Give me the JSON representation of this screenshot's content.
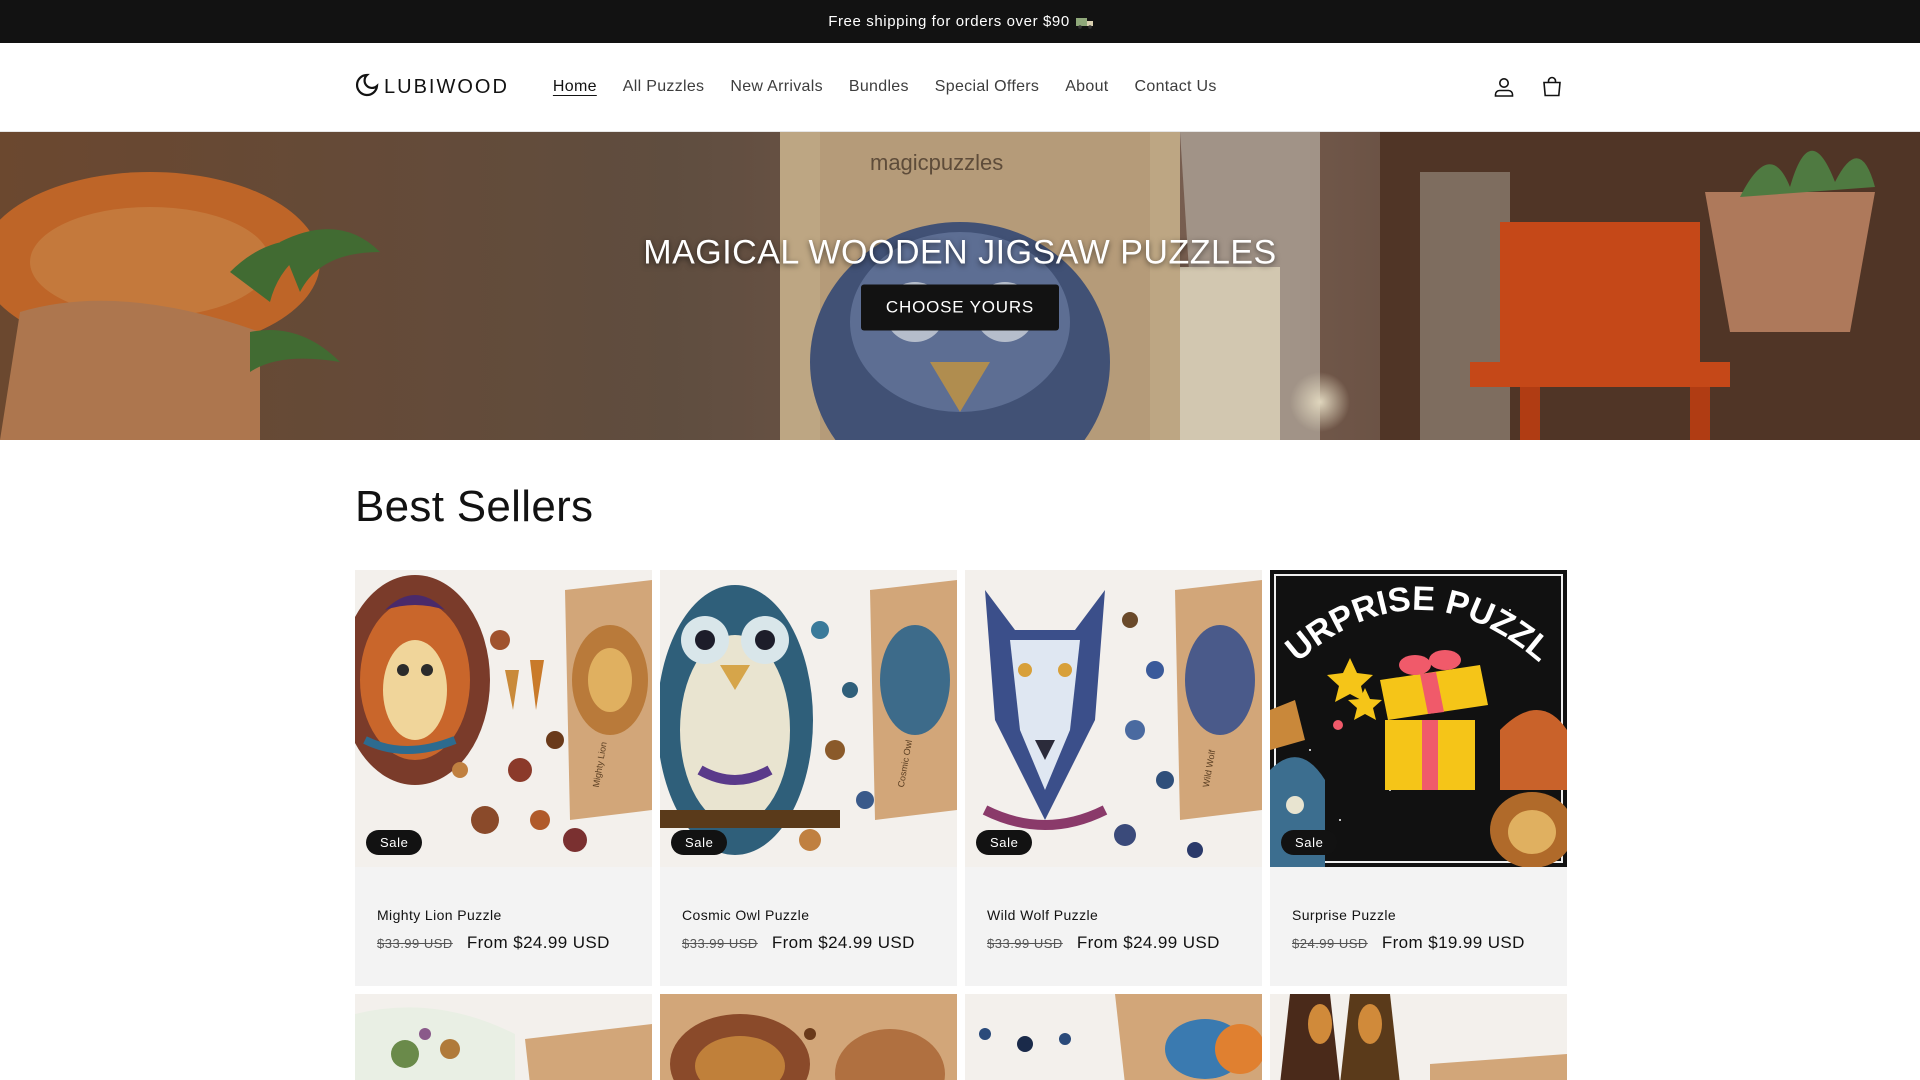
{
  "announcement": {
    "text": "Free shipping for orders over  $90"
  },
  "header": {
    "logo_text": "LUBIWOOD",
    "nav": [
      {
        "label": "Home",
        "active": true
      },
      {
        "label": "All Puzzles"
      },
      {
        "label": "New Arrivals"
      },
      {
        "label": "Bundles"
      },
      {
        "label": "Special Offers"
      },
      {
        "label": "About"
      },
      {
        "label": "Contact Us"
      }
    ],
    "icons": [
      "account-icon",
      "cart-icon"
    ]
  },
  "hero": {
    "title": "MAGICAL WOODEN JIGSAW PUZZLES",
    "button_label": "CHOOSE YOURS",
    "box_brand": "magicpuzzles"
  },
  "best_sellers": {
    "title": "Best Sellers",
    "products": [
      {
        "title": "Mighty Lion Puzzle",
        "badge": "Sale",
        "old_price": "$33.99 USD",
        "price": "From $24.99 USD",
        "box_label": "Mighty Lion"
      },
      {
        "title": "Cosmic Owl Puzzle",
        "badge": "Sale",
        "old_price": "$33.99 USD",
        "price": "From $24.99 USD",
        "box_label": "Cosmic Owl"
      },
      {
        "title": "Wild Wolf Puzzle",
        "badge": "Sale",
        "old_price": "$33.99 USD",
        "price": "From $24.99 USD",
        "box_label": "Wild Wolf"
      },
      {
        "title": "Surprise Puzzle",
        "badge": "Sale",
        "old_price": "$24.99 USD",
        "price": "From $19.99 USD",
        "image_text": "SURPRISE PUZZLE"
      }
    ]
  },
  "colors": {
    "dark": "#121212",
    "card_bg": "#f3f3f3",
    "box": "#d2a679"
  }
}
